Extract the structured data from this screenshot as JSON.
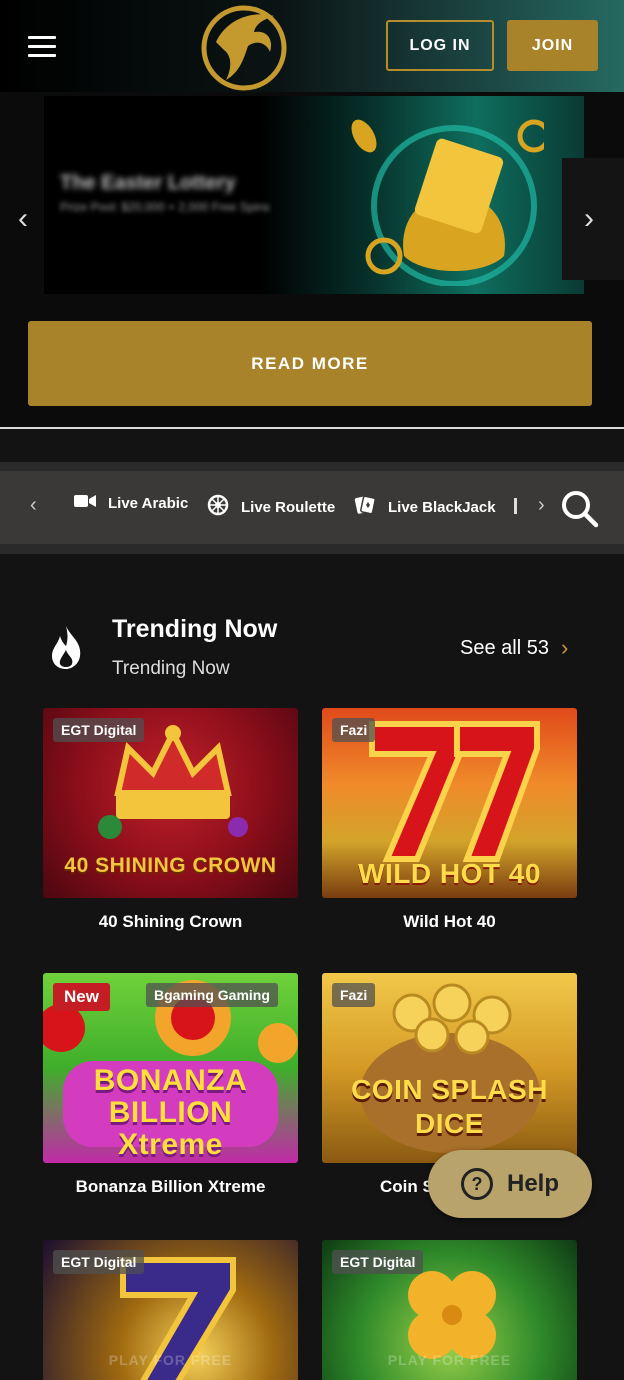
{
  "header": {
    "login_label": "LOG IN",
    "join_label": "JOIN"
  },
  "banner": {
    "title": "The Easter Lottery",
    "subtitle": "Prize Pool: $20,000 + 2,000 Free Spins",
    "read_more_label": "READ MORE"
  },
  "category_bar": {
    "items": [
      {
        "label": "Live Arabic",
        "icon": "video-camera-icon"
      },
      {
        "label": "Live Roulette",
        "icon": "roulette-wheel-icon"
      },
      {
        "label": "Live BlackJack",
        "icon": "playing-cards-icon"
      }
    ]
  },
  "trending": {
    "title": "Trending Now",
    "subtitle": "Trending Now",
    "see_all_label": "See all 53",
    "games": [
      {
        "name": "40 Shining Crown",
        "provider": "EGT Digital",
        "tile_text": "40 SHINING CROWN"
      },
      {
        "name": "Wild Hot 40",
        "provider": "Fazi",
        "tile_text": "WILD HOT 40"
      },
      {
        "name": "Bonanza Billion Xtreme",
        "provider": "Bgaming Gaming",
        "badge": "New",
        "tile_text": "BONANZA BILLION Xtreme"
      },
      {
        "name": "Coin S",
        "provider": "Fazi",
        "tile_text": "COIN SPLASH DICE"
      },
      {
        "name": "",
        "provider": "EGT Digital",
        "tile_text": "PLAY FOR FREE"
      },
      {
        "name": "",
        "provider": "EGT Digital",
        "tile_text": "PLAY FOR FREE"
      }
    ]
  },
  "help": {
    "label": "Help"
  },
  "colors": {
    "gold": "#a8832a",
    "teal": "#256a62",
    "badge_red": "#c41d24",
    "help_bg": "#b8a36b"
  }
}
